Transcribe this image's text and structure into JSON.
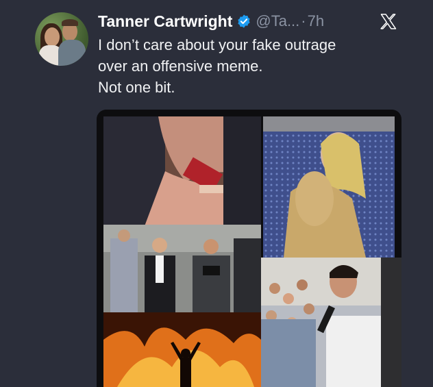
{
  "tweet": {
    "author_name": "Tanner Cartwright",
    "handle": "@Ta...",
    "separator": "·",
    "timestamp": "7h",
    "verified": true,
    "text_lines": [
      "I don’t care about your fake outrage",
      "over an offensive meme.",
      "Not one bit."
    ]
  },
  "icons": {
    "verified": "verified-badge-icon",
    "close": "x-logo-icon"
  },
  "colors": {
    "background": "#2b2e3a",
    "text": "#f1f2f4",
    "muted": "#8b93a3",
    "verified_blue": "#1d9bf0"
  }
}
